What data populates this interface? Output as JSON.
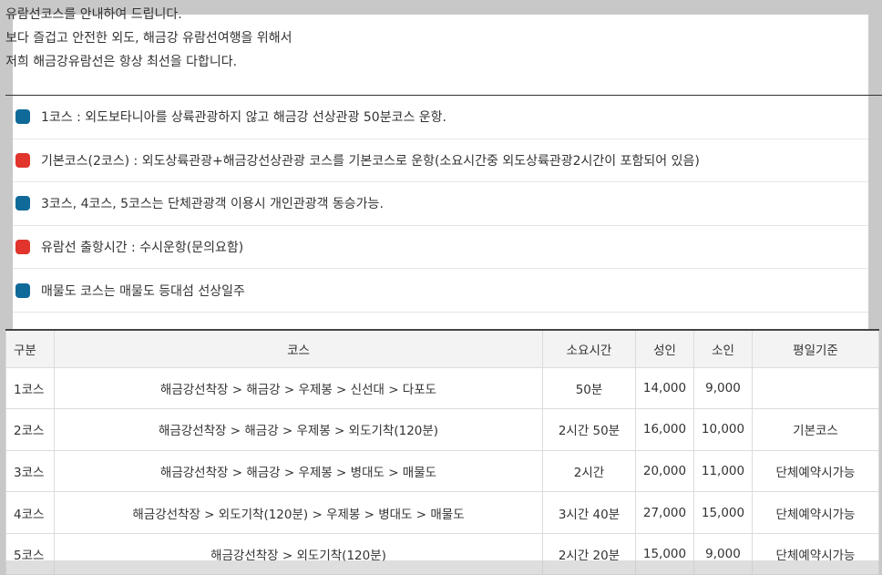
{
  "intro": {
    "line1": "유람선코스를 안내하여 드립니다.",
    "line2": "보다 즐겁고 안전한 외도, 해금강 유람선여행을 위해서",
    "line3": "저희 해금강유람선은 항상 최선을 다합니다."
  },
  "colors": {
    "blue": "#0f6a9a",
    "red": "#e0342c"
  },
  "notes": [
    {
      "color": "blue",
      "text": "1코스 : 외도보타니아를 상륙관광하지 않고 해금강 선상관광 50분코스 운항."
    },
    {
      "color": "red",
      "text": "기본코스(2코스) : 외도상륙관광+해금강선상관광 코스를 기본코스로 운항(소요시간중 외도상륙관광2시간이 포함되어 있음)"
    },
    {
      "color": "blue",
      "text": "3코스, 4코스, 5코스는 단체관광객 이용시 개인관광객 동승가능."
    },
    {
      "color": "red",
      "text": "유람선 출항시간 : 수시운항(문의요함)"
    },
    {
      "color": "blue",
      "text": "매물도 코스는 매물도 등대섬 선상일주"
    }
  ],
  "table": {
    "headers": [
      "구분",
      "코스",
      "소요시간",
      "성인",
      "소인",
      "평일기준"
    ],
    "rows": [
      [
        "1코스",
        "해금강선착장 > 해금강 > 우제봉 > 신선대 > 다포도",
        "50분",
        "14,000",
        "9,000",
        ""
      ],
      [
        "2코스",
        "해금강선착장 > 해금강 > 우제봉 > 외도기착(120분)",
        "2시간 50분",
        "16,000",
        "10,000",
        "기본코스"
      ],
      [
        "3코스",
        "해금강선착장 > 해금강 > 우제봉 > 병대도 > 매물도",
        "2시간",
        "20,000",
        "11,000",
        "단체예약시가능"
      ],
      [
        "4코스",
        "해금강선착장 > 외도기착(120분) > 우제봉 > 병대도 > 매물도",
        "3시간 40분",
        "27,000",
        "15,000",
        "단체예약시가능"
      ],
      [
        "5코스",
        "해금강선착장 > 외도기착(120분)",
        "2시간 20분",
        "15,000",
        "9,000",
        "단체예약시가능"
      ]
    ]
  }
}
